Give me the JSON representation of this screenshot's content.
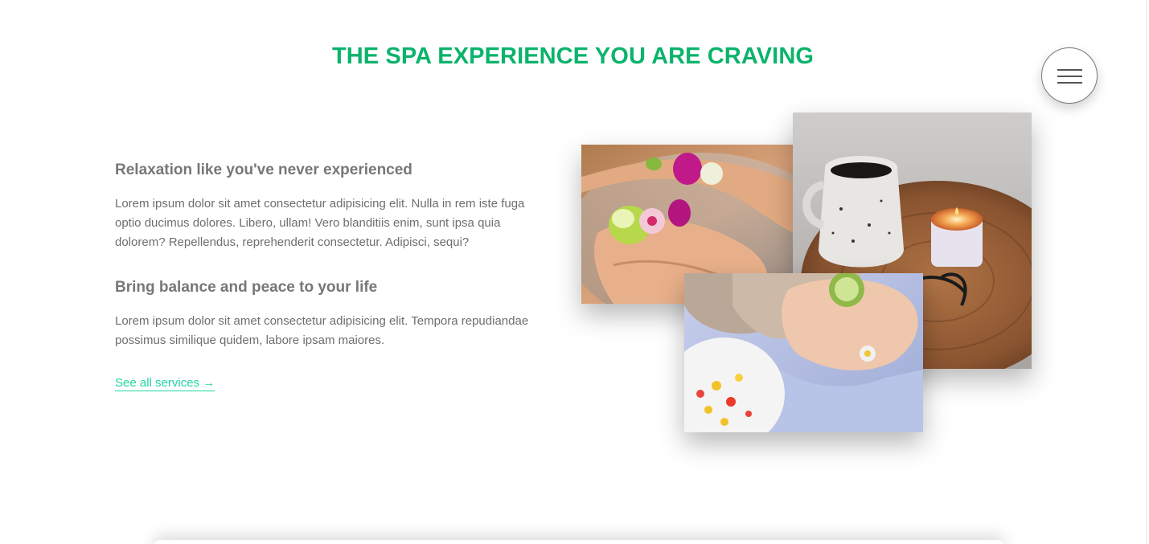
{
  "section": {
    "title": "THE SPA EXPERIENCE YOU ARE CRAVING"
  },
  "menu": {
    "icon": "hamburger-menu-icon"
  },
  "features": [
    {
      "heading": "Relaxation like you've never experienced",
      "text": "Lorem ipsum dolor sit amet consectetur adipisicing elit. Nulla in rem iste fuga optio ducimus dolores. Libero, ullam! Vero blanditiis enim, sunt ipsa quia dolorem? Repellendus, reprehenderit consectetur. Adipisci, sequi?"
    },
    {
      "heading": "Bring balance and peace to your life",
      "text": "Lorem ipsum dolor sit amet consectetur adipisicing elit. Tempora repudiandae possimus similique quidem, labore ipsam maiores."
    }
  ],
  "cta": {
    "label": "See all services →"
  },
  "colors": {
    "accent": "#0bb36b",
    "link": "#1fd6a1",
    "text": "#6e6e6e"
  }
}
